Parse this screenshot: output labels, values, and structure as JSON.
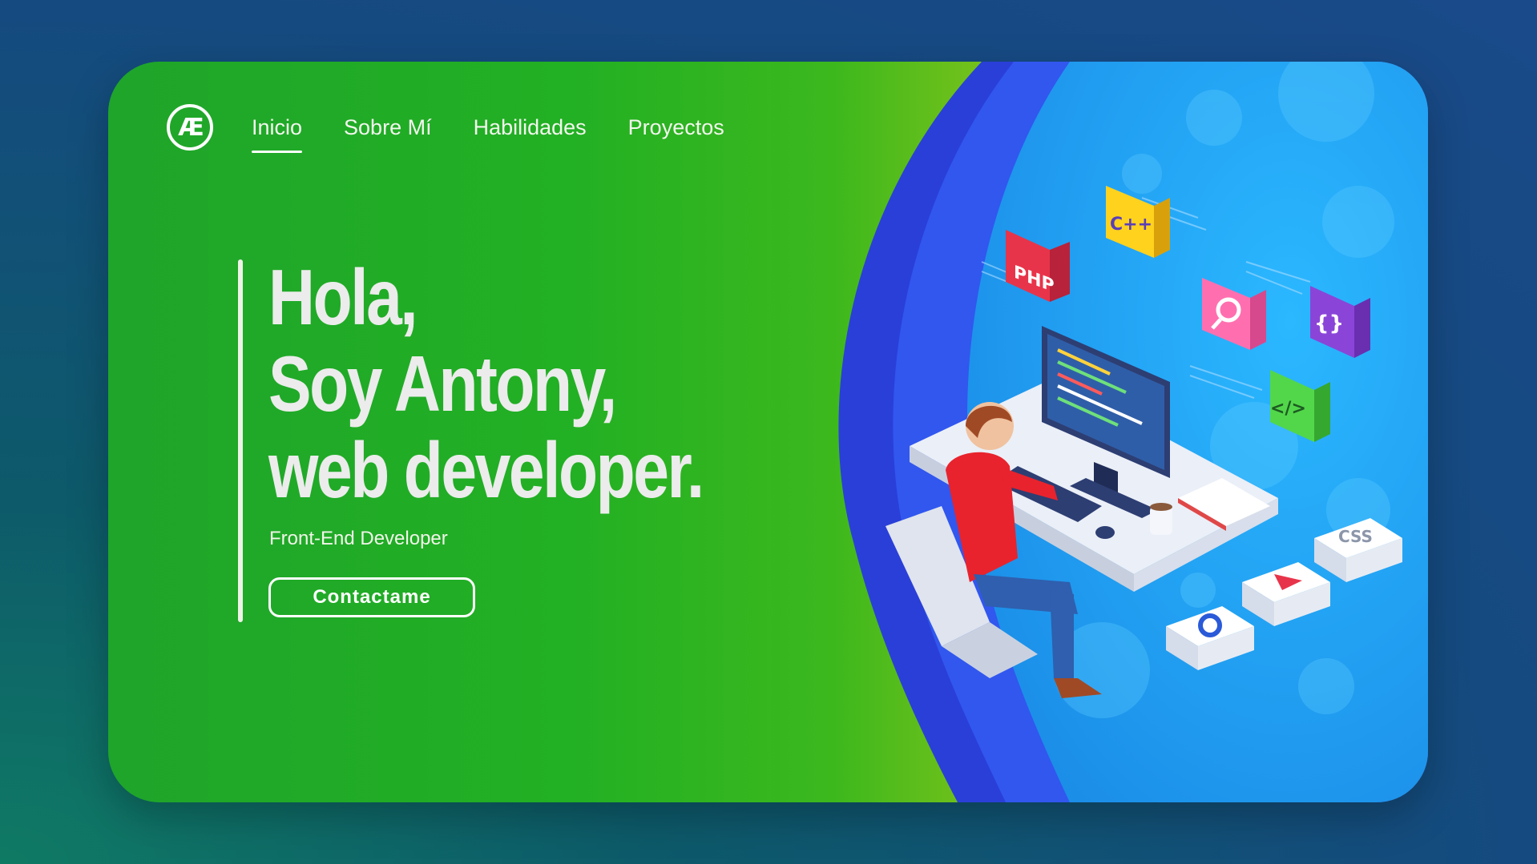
{
  "logo": {
    "text": "Æ"
  },
  "nav": {
    "items": [
      {
        "label": "Inicio",
        "active": true
      },
      {
        "label": "Sobre Mí"
      },
      {
        "label": "Habilidades"
      },
      {
        "label": "Proyectos"
      }
    ]
  },
  "hero": {
    "line1": "Hola,",
    "line2": "Soy Antony,",
    "line3": "web developer.",
    "subtitle": "Front-End Developer",
    "cta_label": "Contactame"
  },
  "illustration": {
    "badges": [
      "PHP",
      "C++",
      "{}",
      "</>",
      "CSS"
    ],
    "icons": [
      "magnifier-icon",
      "play-icon",
      "gear-icon"
    ]
  },
  "colors": {
    "green": "#22b024",
    "blue_ring": "#2a4fe0",
    "sky": "#1fa6f2"
  }
}
